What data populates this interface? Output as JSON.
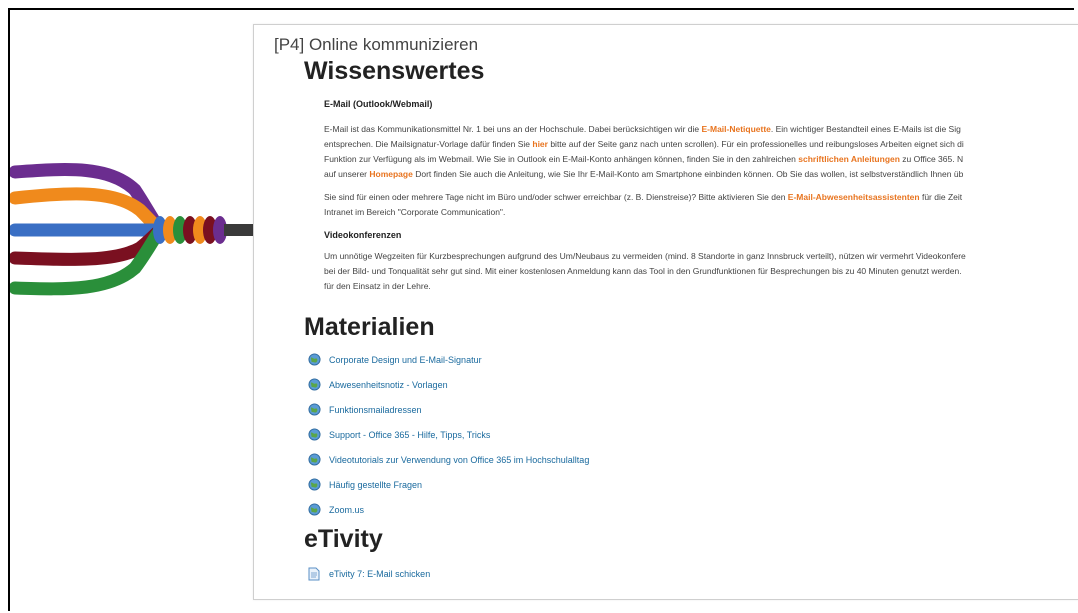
{
  "course": {
    "title": "[P4] Online kommunizieren"
  },
  "sections": {
    "wissenswertes": {
      "heading": "Wissenswertes",
      "email": {
        "heading": "E-Mail (Outlook/Webmail)",
        "p1_l1_a": "E-Mail ist das Kommunikationsmittel Nr. 1 bei uns an der Hochschule. Dabei berücksichtigen wir die ",
        "p1_l1_link": "E-Mail-Netiquette",
        "p1_l1_b": ". Ein wichtiger Bestandteil eines E-Mails ist die Sig",
        "p1_l2_a": "entsprechen. Die Mailsignatur-Vorlage dafür finden Sie ",
        "p1_l2_link": "hier",
        "p1_l2_b": " bitte auf der Seite ganz nach unten scrollen). Für ein professionelles und reibungsloses Arbeiten eignet sich di",
        "p1_l3_a": "Funktion zur Verfügung als im Webmail. Wie Sie in Outlook ein E-Mail-Konto anhängen können, finden Sie in den zahlreichen ",
        "p1_l3_link": "schriftlichen Anleitungen",
        "p1_l3_b": " zu Office 365. N",
        "p1_l4_a": "auf unserer ",
        "p1_l4_link": "Homepage",
        "p1_l4_b": " Dort finden Sie auch die Anleitung, wie Sie Ihr E-Mail-Konto am Smartphone einbinden können. Ob Sie das wollen, ist selbstverständlich Ihnen üb",
        "p2_l1_a": "Sie sind für einen oder mehrere Tage nicht im Büro und/oder schwer erreichbar (z. B. Dienstreise)? Bitte aktivieren Sie den ",
        "p2_l1_link": "E-Mail-Abwesenheitsassistenten",
        "p2_l1_b": " für die Zeit",
        "p2_l2": "Intranet im Bereich \"Corporate Communication\"."
      },
      "video": {
        "heading": "Videokonferenzen",
        "l1": "Um unnötige Wegzeiten für Kurzbesprechungen aufgrund des Um/Neubaus zu vermeiden (mind. 8 Standorte in ganz Innsbruck verteilt), nützen wir vermehrt Videokonfere",
        "l2": "bei der Bild- und Tonqualität sehr gut sind. Mit einer kostenlosen Anmeldung kann das Tool in den Grundfunktionen für Besprechungen bis zu 40 Minuten genutzt werden.",
        "l3": "für den Einsatz in der Lehre."
      }
    },
    "materialien": {
      "heading": "Materialien",
      "items": [
        "Corporate Design und E-Mail-Signatur",
        "Abwesenheitsnotiz - Vorlagen",
        "Funktionsmailadressen",
        "Support - Office 365 - Hilfe, Tipps, Tricks",
        "Videotutorials zur Verwendung von Office 365 im Hochschulalltag",
        "Häufig gestellte Fragen",
        "Zoom.us"
      ]
    },
    "etivity": {
      "heading": "eTivity",
      "items": [
        "eTivity 7: E-Mail schicken"
      ]
    }
  },
  "illustration": {
    "strand_colors": [
      "#6b2d8f",
      "#f08a1c",
      "#3a6fc4",
      "#7a1020",
      "#2a8f3a"
    ],
    "arrow_color": "#3a3a3a"
  },
  "colors": {
    "link": "#1a6a9e",
    "highlight": "#e8741f"
  }
}
